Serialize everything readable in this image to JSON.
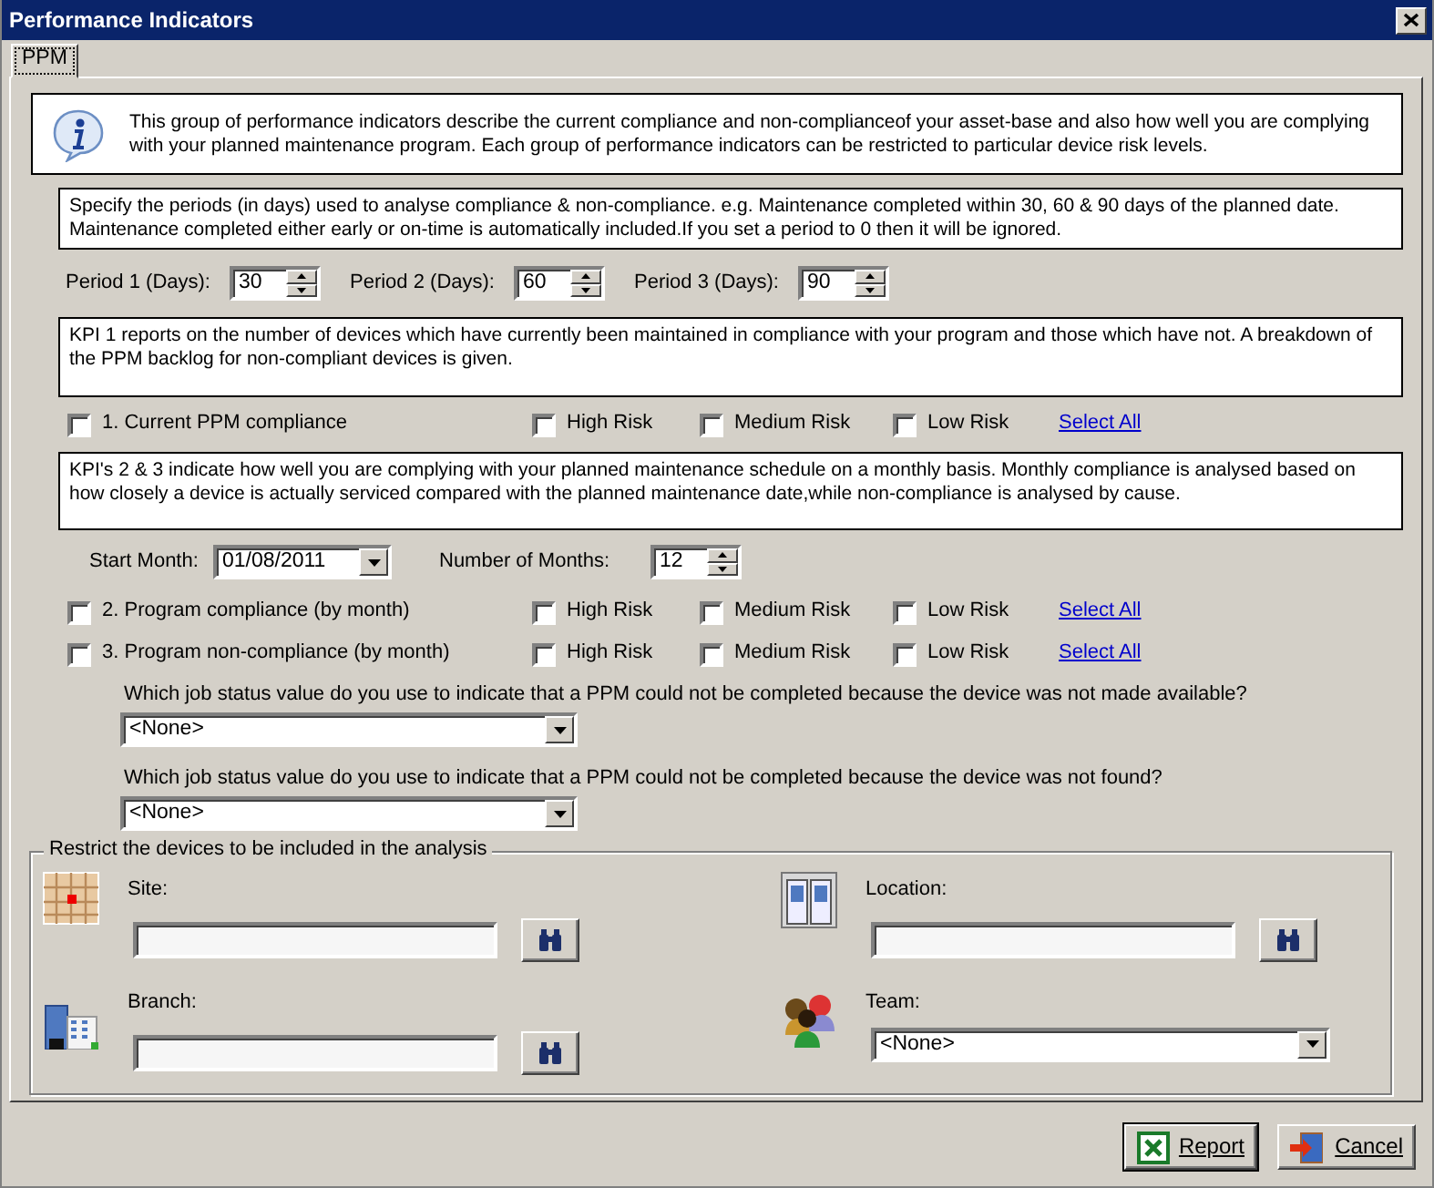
{
  "window": {
    "title": "Performance Indicators"
  },
  "tabs": [
    {
      "label": "PPM",
      "selected": true
    }
  ],
  "intro": "This group of performance indicators describe the current compliance and non-complianceof your asset-base and also how well you are complying with your planned maintenance program. Each group of performance indicators can be restricted to particular device risk levels.",
  "periods": {
    "description": "Specify the periods (in days) used to analyse compliance & non-compliance. e.g. Maintenance completed within 30, 60 & 90 days of the planned date. Maintenance completed either early or on-time is automatically included.If you set a period to 0 then it will be ignored.",
    "fields": [
      {
        "label": "Period 1 (Days):",
        "value": "30"
      },
      {
        "label": "Period 2 (Days):",
        "value": "60"
      },
      {
        "label": "Period 3 (Days):",
        "value": "90"
      }
    ]
  },
  "kpi1": {
    "description": "KPI 1  reports on the number of devices which have currently been maintained in compliance with your program and those which have not. A breakdown of the PPM backlog for non-compliant devices is given.",
    "indicators": [
      {
        "label": "1. Current PPM compliance",
        "checked": false,
        "risks": [
          {
            "label": "High Risk",
            "checked": false
          },
          {
            "label": "Medium Risk",
            "checked": false
          },
          {
            "label": "Low Risk",
            "checked": false
          }
        ],
        "link": "Select All"
      }
    ]
  },
  "kpi23": {
    "description": "KPI's 2 & 3 indicate how well you are complying with your planned maintenance schedule on a monthly basis. Monthly compliance is analysed based on how closely a device is actually serviced compared with the planned maintenance date,while non-compliance is analysed by cause.",
    "start_month": {
      "label": "Start Month:",
      "value": "01/08/2011"
    },
    "months": {
      "label": "Number of Months:",
      "value": "12"
    },
    "indicators": [
      {
        "label": "2. Program compliance (by month)",
        "checked": false,
        "risks": [
          {
            "label": "High Risk",
            "checked": false
          },
          {
            "label": "Medium Risk",
            "checked": false
          },
          {
            "label": "Low Risk",
            "checked": false
          }
        ],
        "link": "Select All"
      },
      {
        "label": "3. Program non-compliance (by month)",
        "checked": false,
        "risks": [
          {
            "label": "High Risk",
            "checked": false
          },
          {
            "label": "Medium Risk",
            "checked": false
          },
          {
            "label": "Low Risk",
            "checked": false
          }
        ],
        "link": "Select All"
      }
    ],
    "questions": [
      {
        "text": "Which job status value do you use to indicate that a PPM could not be completed because the device was not made available?",
        "value": "<None>"
      },
      {
        "text": "Which job status value do you use to indicate that a PPM could not be completed because the device was not found?",
        "value": "<None>"
      }
    ]
  },
  "restrict": {
    "legend": "Restrict the devices to be included in the analysis",
    "fields": [
      {
        "label": "Site:",
        "kind": "lookup"
      },
      {
        "label": "Location:",
        "kind": "lookup"
      },
      {
        "label": "Branch:",
        "kind": "lookup"
      },
      {
        "label": "Team:",
        "kind": "dropdown",
        "value": "<None>"
      }
    ]
  },
  "buttons": [
    {
      "label": "Report",
      "kind": "report",
      "default": true
    },
    {
      "label": "Cancel",
      "kind": "cancel",
      "default": false
    }
  ]
}
